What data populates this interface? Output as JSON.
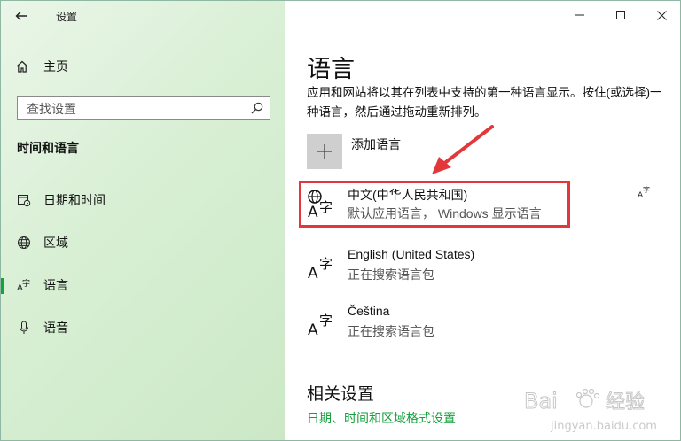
{
  "window": {
    "title": "设置"
  },
  "sidebar": {
    "home_label": "主页",
    "search": {
      "placeholder": "查找设置",
      "value": ""
    },
    "section_title": "时间和语言",
    "items": [
      {
        "label": "日期和时间",
        "icon": "calendar-clock-icon"
      },
      {
        "label": "区域",
        "icon": "globe-icon"
      },
      {
        "label": "语言",
        "icon": "language-icon",
        "active": true
      },
      {
        "label": "语音",
        "icon": "microphone-icon"
      }
    ]
  },
  "main": {
    "title": "语言",
    "description": "应用和网站将以其在列表中支持的第一种语言显示。按住(或选择)一种语言，然后通过拖动重新排列。",
    "add_language_label": "添加语言",
    "languages": [
      {
        "name": "中文(中华人民共和国)",
        "status": "默认应用语言， Windows 显示语言"
      },
      {
        "name": "English (United States)",
        "status": "正在搜索语言包"
      },
      {
        "name": "Čeština",
        "status": "正在搜索语言包"
      }
    ],
    "related_title": "相关设置",
    "related_link": "日期、时间和区域格式设置"
  },
  "watermark": {
    "text_cn": "经验",
    "text_brand": "Bai",
    "url": "jingyan.baidu.com"
  },
  "colors": {
    "accent": "#15a33a",
    "highlight": "#e3383b",
    "sidebar_bg": "#d8efd4"
  }
}
